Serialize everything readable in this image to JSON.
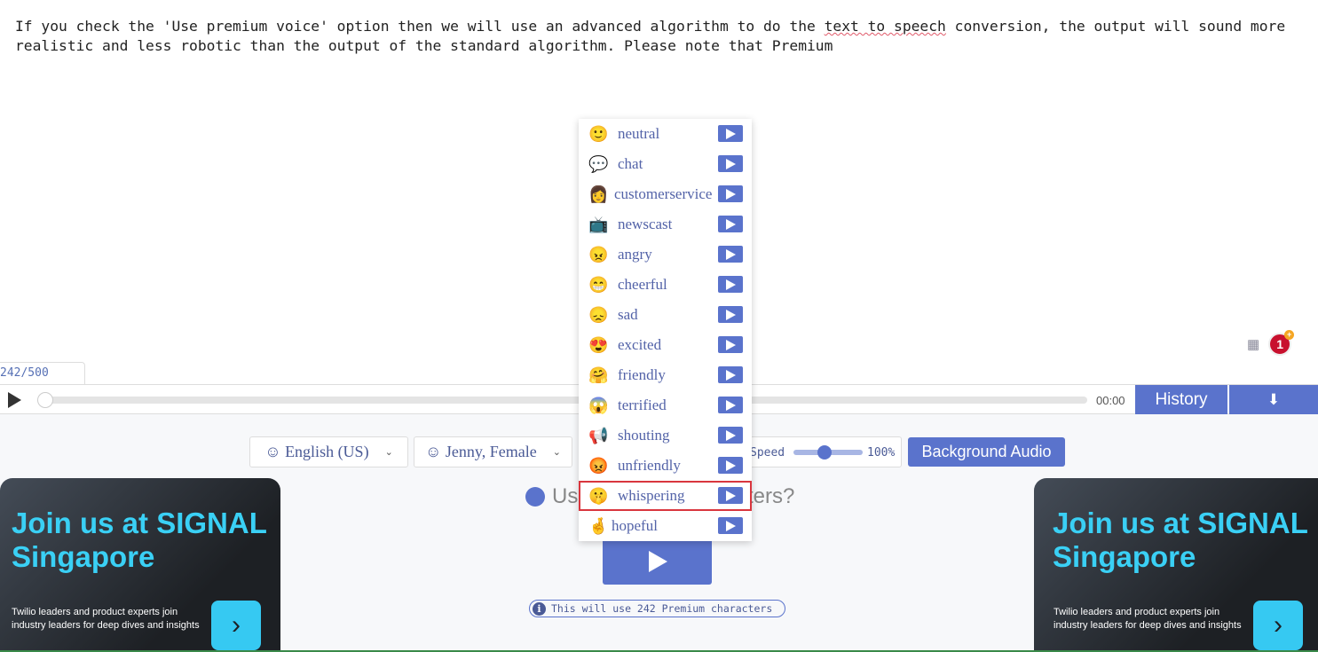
{
  "editor": {
    "text_before": "If you check the 'Use premium voice' option then we will use an advanced algorithm to do the ",
    "text_underlined": "text to speech",
    "text_after": " conversion, the output will sound more realistic and less robotic than the output of the standard algorithm. Please note that Premium"
  },
  "counter": "242/500",
  "notification_count": "1",
  "player": {
    "time": "00:00",
    "history_label": "History",
    "progress": 0
  },
  "controls": {
    "language": "☺ English (US)",
    "voice": "☺ Jenny, Female",
    "speed_label": "Speed",
    "speed_value": "100%",
    "speed_percent": 100,
    "background_audio_label": "Background Audio"
  },
  "premium_question": {
    "start": "Us",
    "end": "ters?"
  },
  "info_text": "This will use 242 Premium characters",
  "styles_menu": {
    "selected": "whispering",
    "items": [
      {
        "emoji": "🙂",
        "label": "neutral"
      },
      {
        "emoji": "💬",
        "label": "chat"
      },
      {
        "emoji": "👩",
        "label": "customerservice"
      },
      {
        "emoji": "📺",
        "label": "newscast"
      },
      {
        "emoji": "😠",
        "label": "angry"
      },
      {
        "emoji": "😁",
        "label": "cheerful"
      },
      {
        "emoji": "😞",
        "label": "sad"
      },
      {
        "emoji": "😍",
        "label": "excited"
      },
      {
        "emoji": "🤗",
        "label": "friendly"
      },
      {
        "emoji": "😱",
        "label": "terrified"
      },
      {
        "emoji": "📢",
        "label": "shouting"
      },
      {
        "emoji": "😡",
        "label": "unfriendly"
      },
      {
        "emoji": "🤫",
        "label": "whispering"
      },
      {
        "emoji": "🤞",
        "label": "hopeful"
      }
    ]
  },
  "ads": [
    {
      "title": "Join us at SIGNAL Singapore",
      "body": "Twilio leaders and product experts join industry leaders for deep dives and insights"
    },
    {
      "title": "Join us at SIGNAL Singapore",
      "body": "Twilio leaders and product experts join industry leaders for deep dives and insights"
    }
  ],
  "colors": {
    "accent": "#5a73cc",
    "ad_title": "#3ad0f5",
    "highlight": "#d9363e"
  }
}
